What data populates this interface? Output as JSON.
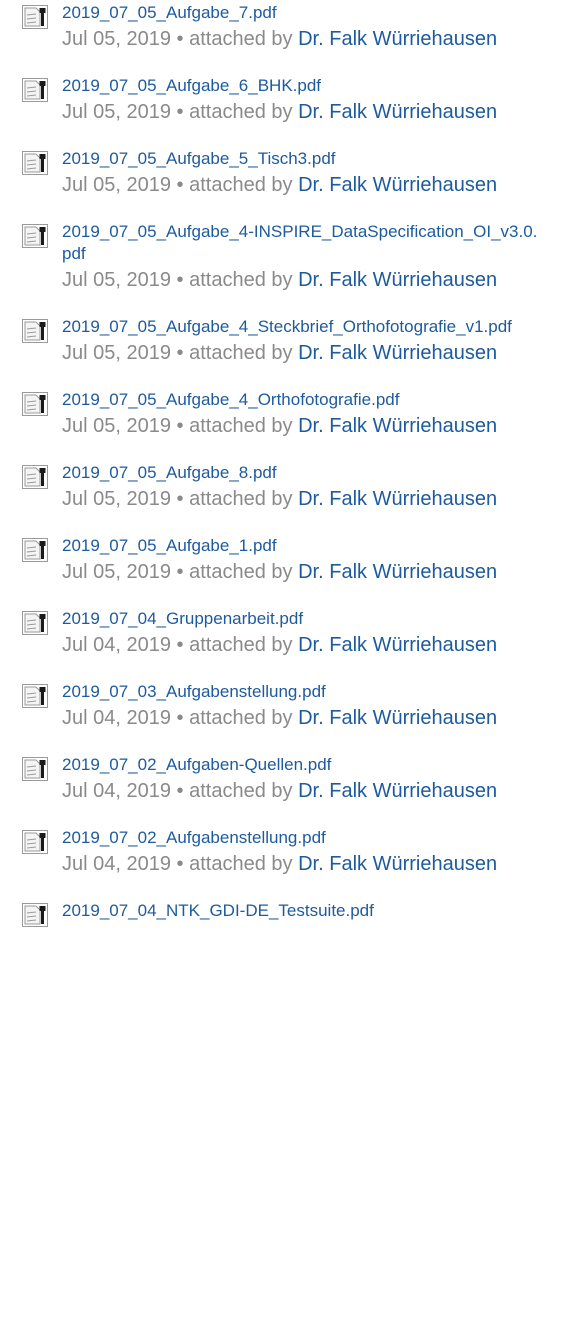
{
  "attachments": [
    {
      "filename": "2019_07_05_Aufgabe_7.pdf",
      "date": "Jul 05, 2019",
      "attached_by": "attached by",
      "author": "Dr. Falk Würriehausen"
    },
    {
      "filename": "2019_07_05_Aufgabe_6_BHK.pdf",
      "date": "Jul 05, 2019",
      "attached_by": "attached by",
      "author": "Dr. Falk Würriehausen"
    },
    {
      "filename": "2019_07_05_Aufgabe_5_Tisch3.pdf",
      "date": "Jul 05, 2019",
      "attached_by": "attached by",
      "author": "Dr. Falk Würriehausen"
    },
    {
      "filename": "2019_07_05_Aufgabe_4-INSPIRE_DataSpecification_OI_v3.0.pdf",
      "date": "Jul 05, 2019",
      "attached_by": "attached by",
      "author": "Dr. Falk Würriehausen"
    },
    {
      "filename": "2019_07_05_Aufgabe_4_Steckbrief_Orthofotografie_v1.pdf",
      "date": "Jul 05, 2019",
      "attached_by": "attached by",
      "author": "Dr. Falk Würriehausen"
    },
    {
      "filename": "2019_07_05_Aufgabe_4_Orthofotografie.pdf",
      "date": "Jul 05, 2019",
      "attached_by": "attached by",
      "author": "Dr. Falk Würriehausen"
    },
    {
      "filename": "2019_07_05_Aufgabe_8.pdf",
      "date": "Jul 05, 2019",
      "attached_by": "attached by",
      "author": "Dr. Falk Würriehausen"
    },
    {
      "filename": "2019_07_05_Aufgabe_1.pdf",
      "date": "Jul 05, 2019",
      "attached_by": "attached by",
      "author": "Dr. Falk Würriehausen"
    },
    {
      "filename": "2019_07_04_Gruppenarbeit.pdf",
      "date": "Jul 04, 2019",
      "attached_by": "attached by",
      "author": "Dr. Falk Würriehausen"
    },
    {
      "filename": "2019_07_03_Aufgabenstellung.pdf",
      "date": "Jul 04, 2019",
      "attached_by": "attached by",
      "author": "Dr. Falk Würriehausen"
    },
    {
      "filename": "2019_07_02_Aufgaben-Quellen.pdf",
      "date": "Jul 04, 2019",
      "attached_by": "attached by",
      "author": "Dr. Falk Würriehausen"
    },
    {
      "filename": "2019_07_02_Aufgabenstellung.pdf",
      "date": "Jul 04, 2019",
      "attached_by": "attached by",
      "author": "Dr. Falk Würriehausen"
    },
    {
      "filename": "2019_07_04_NTK_GDI-DE_Testsuite.pdf",
      "date": "",
      "attached_by": "",
      "author": ""
    }
  ],
  "icon": "pdf-file-icon",
  "colors": {
    "link": "#1d5a9e",
    "meta": "#8a8a8a"
  }
}
